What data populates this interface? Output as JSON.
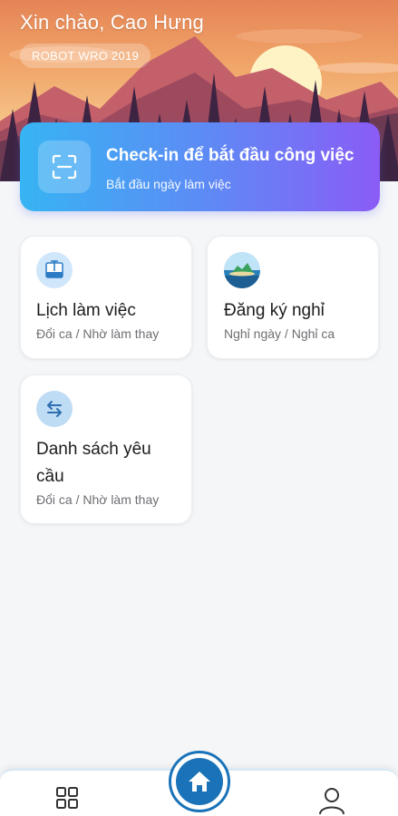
{
  "header": {
    "greeting": "Xin chào, Cao Hưng",
    "organization": "ROBOT WRO 2019"
  },
  "checkin": {
    "title": "Check-in để bắt đầu công việc",
    "subtitle": "Bắt đầu ngày làm việc",
    "icon": "scan-icon"
  },
  "features": [
    {
      "title": "Lịch làm việc",
      "subtitle": "Đổi ca / Nhờ làm thay",
      "icon": "calendar-icon"
    },
    {
      "title": "Đăng ký nghỉ",
      "subtitle": "Nghỉ ngày / Nghỉ ca",
      "icon": "island-icon"
    },
    {
      "title_line1": "Danh sách yêu",
      "title_line2": "cầu",
      "subtitle": "Đổi ca / Nhờ làm thay",
      "icon": "swap-icon"
    }
  ],
  "bottom_nav": {
    "items": [
      {
        "icon": "grid-icon"
      },
      {
        "icon": "home-icon",
        "active": true
      },
      {
        "icon": "user-icon"
      }
    ]
  },
  "colors": {
    "accent": "#1a73b8",
    "checkin_gradient_start": "#37b4f3",
    "checkin_gradient_end": "#8a5cf6",
    "background": "#f5f6f8"
  }
}
